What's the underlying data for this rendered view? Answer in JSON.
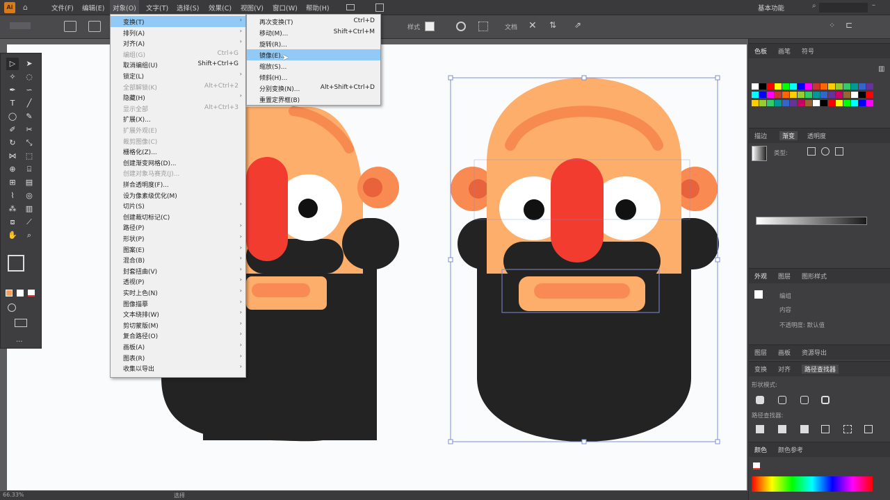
{
  "app": {
    "logo": "Ai"
  },
  "menubar": {
    "items": [
      "文件(F)",
      "编辑(E)",
      "对象(O)",
      "文字(T)",
      "选择(S)",
      "效果(C)",
      "视图(V)",
      "窗口(W)",
      "帮助(H)"
    ],
    "workspace": "基本功能",
    "search_icon": "search-icon"
  },
  "control": {
    "style_label": "样式",
    "doc_label": "文档"
  },
  "object_menu": {
    "items": [
      {
        "label": "变换(T)",
        "shortcut": "",
        "sub": true,
        "disabled": false,
        "highlight": true
      },
      {
        "label": "排列(A)",
        "shortcut": "",
        "sub": true,
        "disabled": false
      },
      {
        "label": "对齐(A)",
        "shortcut": "",
        "sub": true,
        "disabled": false
      },
      {
        "label": "编组(G)",
        "shortcut": "Ctrl+G",
        "sub": false,
        "disabled": true
      },
      {
        "label": "取消编组(U)",
        "shortcut": "Shift+Ctrl+G",
        "sub": false,
        "disabled": false
      },
      {
        "label": "锁定(L)",
        "shortcut": "",
        "sub": true,
        "disabled": false
      },
      {
        "label": "全部解锁(K)",
        "shortcut": "Alt+Ctrl+2",
        "sub": false,
        "disabled": true
      },
      {
        "label": "隐藏(H)",
        "shortcut": "",
        "sub": true,
        "disabled": false
      },
      {
        "label": "显示全部",
        "shortcut": "Alt+Ctrl+3",
        "sub": false,
        "disabled": true
      },
      {
        "label": "扩展(X)...",
        "shortcut": "",
        "sub": false,
        "disabled": false
      },
      {
        "label": "扩展外观(E)",
        "shortcut": "",
        "sub": false,
        "disabled": true
      },
      {
        "label": "裁剪图像(C)",
        "shortcut": "",
        "sub": false,
        "disabled": true
      },
      {
        "label": "栅格化(Z)...",
        "shortcut": "",
        "sub": false,
        "disabled": false
      },
      {
        "label": "创建渐变网格(D)...",
        "shortcut": "",
        "sub": false,
        "disabled": false
      },
      {
        "label": "创建对象马赛克(J)...",
        "shortcut": "",
        "sub": false,
        "disabled": true
      },
      {
        "label": "拼合透明度(F)...",
        "shortcut": "",
        "sub": false,
        "disabled": false
      },
      {
        "label": "设为像素级优化(M)",
        "shortcut": "",
        "sub": false,
        "disabled": false
      },
      {
        "label": "切片(S)",
        "shortcut": "",
        "sub": true,
        "disabled": false
      },
      {
        "label": "创建裁切标记(C)",
        "shortcut": "",
        "sub": false,
        "disabled": false
      },
      {
        "label": "路径(P)",
        "shortcut": "",
        "sub": true,
        "disabled": false
      },
      {
        "label": "形状(P)",
        "shortcut": "",
        "sub": true,
        "disabled": false
      },
      {
        "label": "图案(E)",
        "shortcut": "",
        "sub": true,
        "disabled": false
      },
      {
        "label": "混合(B)",
        "shortcut": "",
        "sub": true,
        "disabled": false
      },
      {
        "label": "封套扭曲(V)",
        "shortcut": "",
        "sub": true,
        "disabled": false
      },
      {
        "label": "透视(P)",
        "shortcut": "",
        "sub": true,
        "disabled": false
      },
      {
        "label": "实时上色(N)",
        "shortcut": "",
        "sub": true,
        "disabled": false
      },
      {
        "label": "图像描摹",
        "shortcut": "",
        "sub": true,
        "disabled": false
      },
      {
        "label": "文本绕排(W)",
        "shortcut": "",
        "sub": true,
        "disabled": false
      },
      {
        "label": "剪切蒙版(M)",
        "shortcut": "",
        "sub": true,
        "disabled": false
      },
      {
        "label": "复合路径(O)",
        "shortcut": "",
        "sub": true,
        "disabled": false
      },
      {
        "label": "画板(A)",
        "shortcut": "",
        "sub": true,
        "disabled": false
      },
      {
        "label": "图表(R)",
        "shortcut": "",
        "sub": true,
        "disabled": false
      },
      {
        "label": "收集以导出",
        "shortcut": "",
        "sub": true,
        "disabled": false
      }
    ]
  },
  "transform_menu": {
    "items": [
      {
        "label": "再次变换(T)",
        "shortcut": "Ctrl+D",
        "highlight": false
      },
      {
        "label": "移动(M)...",
        "shortcut": "Shift+Ctrl+M",
        "highlight": false
      },
      {
        "label": "旋转(R)...",
        "shortcut": "",
        "highlight": false
      },
      {
        "label": "镜像(E)...",
        "shortcut": "",
        "highlight": true
      },
      {
        "label": "缩放(S)...",
        "shortcut": "",
        "highlight": false
      },
      {
        "label": "倾斜(H)...",
        "shortcut": "",
        "highlight": false
      },
      {
        "label": "分别变换(N)...",
        "shortcut": "Alt+Shift+Ctrl+D",
        "highlight": false
      },
      {
        "label": "重置定界框(B)",
        "shortcut": "",
        "highlight": false
      }
    ]
  },
  "panels": {
    "swatch_tabs": [
      "色板",
      "画笔",
      "符号"
    ],
    "gradient_tabs": [
      "描边",
      "渐变",
      "透明度"
    ],
    "gradient_type_label": "类型:",
    "appearance_tabs": [
      "外观",
      "图层",
      "图形样式"
    ],
    "appearance_items": [
      "编组",
      "内容",
      "不透明度: 默认值"
    ],
    "pathfinder_tabs": [
      "变换",
      "对齐",
      "路径查找器"
    ],
    "pathfinder_label1": "形状模式:",
    "pathfinder_label2": "路径查找器:",
    "layers_tabs": [
      "图层",
      "画板",
      "资源导出"
    ],
    "color_tabs": [
      "颜色",
      "颜色参考"
    ],
    "swatch_colors": [
      "#ffffff",
      "#000000",
      "#ff0000",
      "#ffff00",
      "#00ff00",
      "#00ffff",
      "#0000ff",
      "#ff00ff",
      "#cc3333",
      "#ff6600",
      "#ffcc00",
      "#99cc33",
      "#33cc66",
      "#009999",
      "#3366cc",
      "#663399",
      "#cc0066",
      "#996633"
    ]
  },
  "status": {
    "zoom": "66.33%",
    "mode": "选择"
  },
  "colors": {
    "skin": "#fdae6b",
    "skin_dark": "#f78a4f",
    "nose": "#f23c30",
    "beard": "#232324",
    "mouth": "#fdae6b",
    "mouth_inner": "#fa8a55",
    "ear_inner": "#e8633b"
  }
}
